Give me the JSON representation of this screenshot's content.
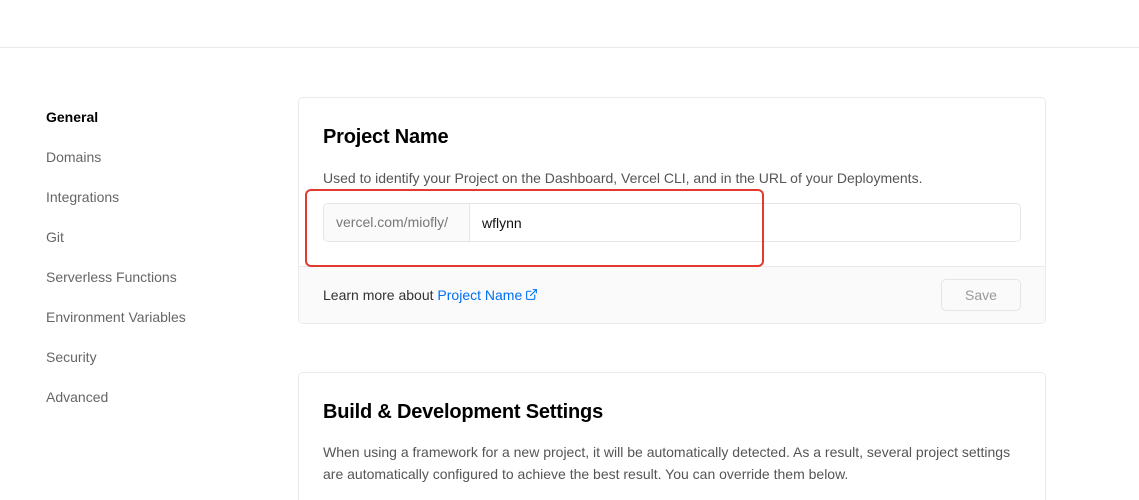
{
  "sidebar": {
    "items": [
      {
        "label": "General",
        "active": true
      },
      {
        "label": "Domains"
      },
      {
        "label": "Integrations"
      },
      {
        "label": "Git"
      },
      {
        "label": "Serverless Functions"
      },
      {
        "label": "Environment Variables"
      },
      {
        "label": "Security"
      },
      {
        "label": "Advanced"
      }
    ]
  },
  "project_name_card": {
    "title": "Project Name",
    "description": "Used to identify your Project on the Dashboard, Vercel CLI, and in the URL of your Deployments.",
    "url_prefix": "vercel.com/miofly/",
    "input_value": "wflynn",
    "footer_text": "Learn more about",
    "footer_link": "Project Name",
    "save_label": "Save"
  },
  "build_card": {
    "title": "Build & Development Settings",
    "description": "When using a framework for a new project, it will be automatically detected. As a result, several project settings are automatically configured to achieve the best result. You can override them below."
  },
  "colors": {
    "link": "#0070f3",
    "highlight": "#e23a2e"
  },
  "icons": {
    "external_link": "external-link-icon"
  }
}
